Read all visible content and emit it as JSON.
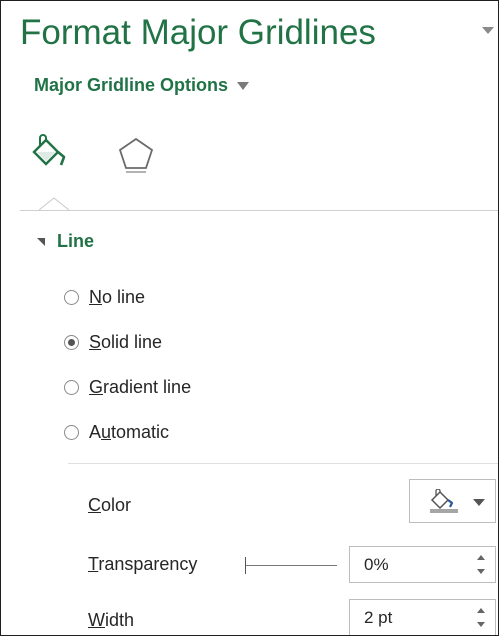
{
  "pane": {
    "title": "Format Major Gridlines",
    "options_label": "Major Gridline Options",
    "tabs": [
      {
        "icon": "fill-line-icon",
        "active": true
      },
      {
        "icon": "effects-pentagon-icon",
        "active": false
      }
    ]
  },
  "line_section": {
    "header": "Line",
    "radios": [
      {
        "pre": "",
        "mnemonic": "N",
        "post": "o line",
        "checked": false
      },
      {
        "pre": "",
        "mnemonic": "S",
        "post": "olid line",
        "checked": true
      },
      {
        "pre": "",
        "mnemonic": "G",
        "post": "radient line",
        "checked": false
      },
      {
        "pre": "A",
        "mnemonic": "u",
        "post": "tomatic",
        "checked": false
      }
    ],
    "color": {
      "mnemonic": "C",
      "rest": "olor",
      "icon": "paint-bucket-icon"
    },
    "transparency": {
      "mnemonic": "T",
      "rest": "ransparency",
      "value": "0%",
      "level": 0
    },
    "width": {
      "mnemonic": "W",
      "rest": "idth",
      "value": "2 pt"
    }
  },
  "colors": {
    "accent": "#217346",
    "text": "#262626",
    "selected_color": "#2b579a"
  }
}
